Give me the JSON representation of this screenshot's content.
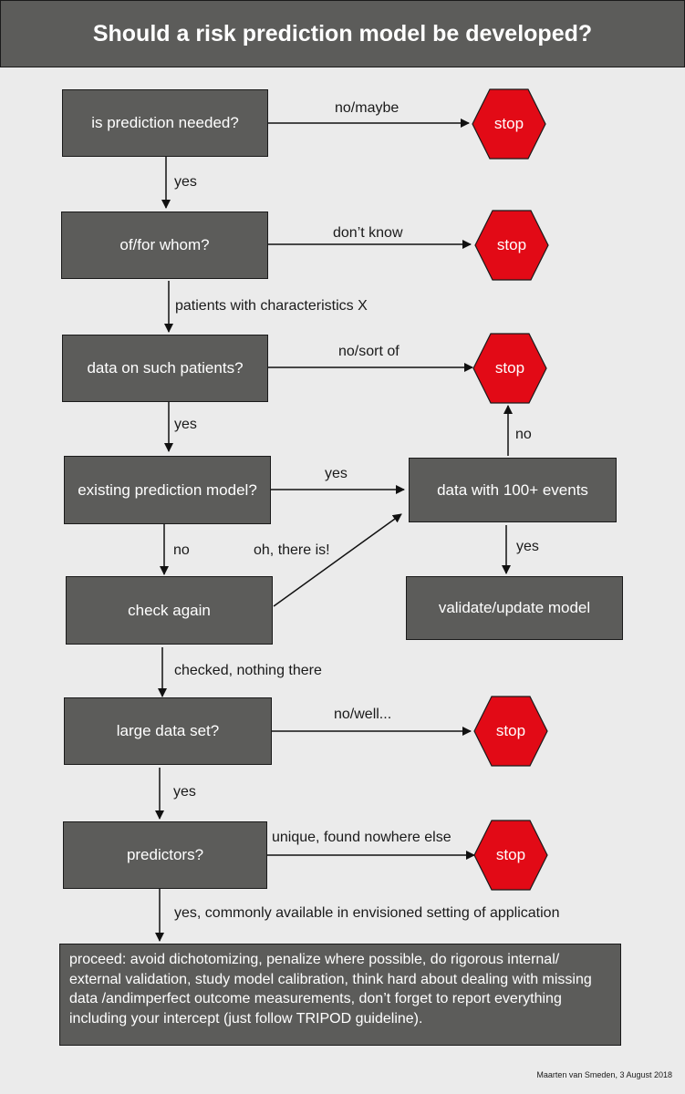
{
  "title": "Should a risk prediction model be developed?",
  "colors": {
    "box_fill": "#5c5c5a",
    "stop_fill": "#e20a16",
    "background": "#ebebeb"
  },
  "nodes": {
    "q1": "is prediction needed?",
    "q2": "of/for whom?",
    "q3": "data on such patients?",
    "q4": "existing prediction model?",
    "q5": "check again",
    "q6": "large data set?",
    "q7": "predictors?",
    "events": "data with 100+ events",
    "validate": "validate/update model",
    "proceed": "proceed: avoid dichotomizing, penalize where possible, do rigorous internal/ external validation, study model calibration, think hard about dealing with missing data /andimperfect outcome measurements, don’t forget to report everything including your intercept (just follow TRIPOD guideline).",
    "stop": "stop"
  },
  "edges": {
    "q1_stop": "no/maybe",
    "q1_q2": "yes",
    "q2_stop": "don’t know",
    "q2_q3": "patients with characteristics X",
    "q3_stop": "no/sort of",
    "q3_q4": "yes",
    "q4_events": "yes",
    "q4_q5": "no",
    "q5_events": "oh, there is!",
    "events_stop": "no",
    "events_validate": "yes",
    "q5_q6": "checked, nothing there",
    "q6_stop": "no/well...",
    "q6_q7": "yes",
    "q7_stop": "unique, found nowhere else",
    "q7_proceed": "yes, commonly available in envisioned setting of application"
  },
  "credit": "Maarten van Smeden, 3 August 2018"
}
